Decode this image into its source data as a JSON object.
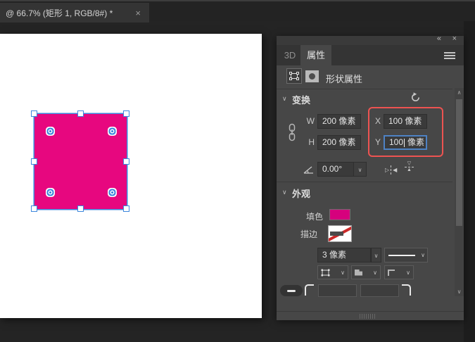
{
  "window": {
    "tab_title": "@ 66.7% (矩形 1, RGB/8#) *"
  },
  "icons": {
    "close": "×",
    "collapse": "«",
    "chevron_down": "∨",
    "scroll_up": "∧",
    "scroll_down": "∨",
    "flip_right_outline": "▷",
    "flip_left_filled": "◀",
    "flip_down_outline": "▽",
    "flip_up_filled": "▲"
  },
  "panel": {
    "tab_3d": "3D",
    "tab_properties": "属性",
    "toolbar_title": "形状属性",
    "transform": {
      "title": "变换",
      "w_label": "W",
      "w_value": "200 像素",
      "h_label": "H",
      "h_value": "200 像素",
      "x_label": "X",
      "x_value": "100 像素",
      "y_label": "Y",
      "y_value_number": "100",
      "y_value_unit": "像素",
      "angle_value": "0.00°"
    },
    "appearance": {
      "title": "外观",
      "fill_label": "填色",
      "stroke_label": "描边",
      "stroke_width_value": "3 像素"
    }
  },
  "colors": {
    "shape_fill": "#e7077f",
    "fill_swatch": "#d6017d",
    "annotation_red": "#ed5351",
    "selection_blue": "#3c87dd",
    "focus_blue": "#4e82c4"
  }
}
